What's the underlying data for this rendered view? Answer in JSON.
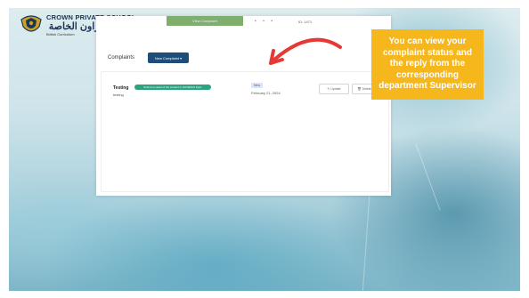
{
  "header": {
    "school_name_en": "CROWN PRIVATE SCHOOL",
    "school_name_ar": "مدرسة كراون الخاصة",
    "curriculum": "British Curriculum",
    "crest_icon": "school-crest-icon"
  },
  "panel": {
    "top_tab_label": "View Complaint",
    "top_number": "ID: 1471",
    "section_title": "Complaints",
    "new_button_label": "New Complaint ▾"
  },
  "complaint": {
    "title": "Testing",
    "department_pill": "Submit to Head of the student in IGCSE/KS Dept.",
    "description": "testing",
    "status": "New",
    "date": "February 21, 2024",
    "update_label": "Update",
    "delete_label": "Delete"
  },
  "callout": {
    "lines": [
      "You can view your",
      "complaint status and",
      "the reply from the",
      "corresponding",
      "department Supervisor"
    ],
    "color": "#f6b71c"
  },
  "colors": {
    "arrow": "#e53935",
    "primary_button": "#1f4d7a",
    "pill": "#2ea37f"
  }
}
